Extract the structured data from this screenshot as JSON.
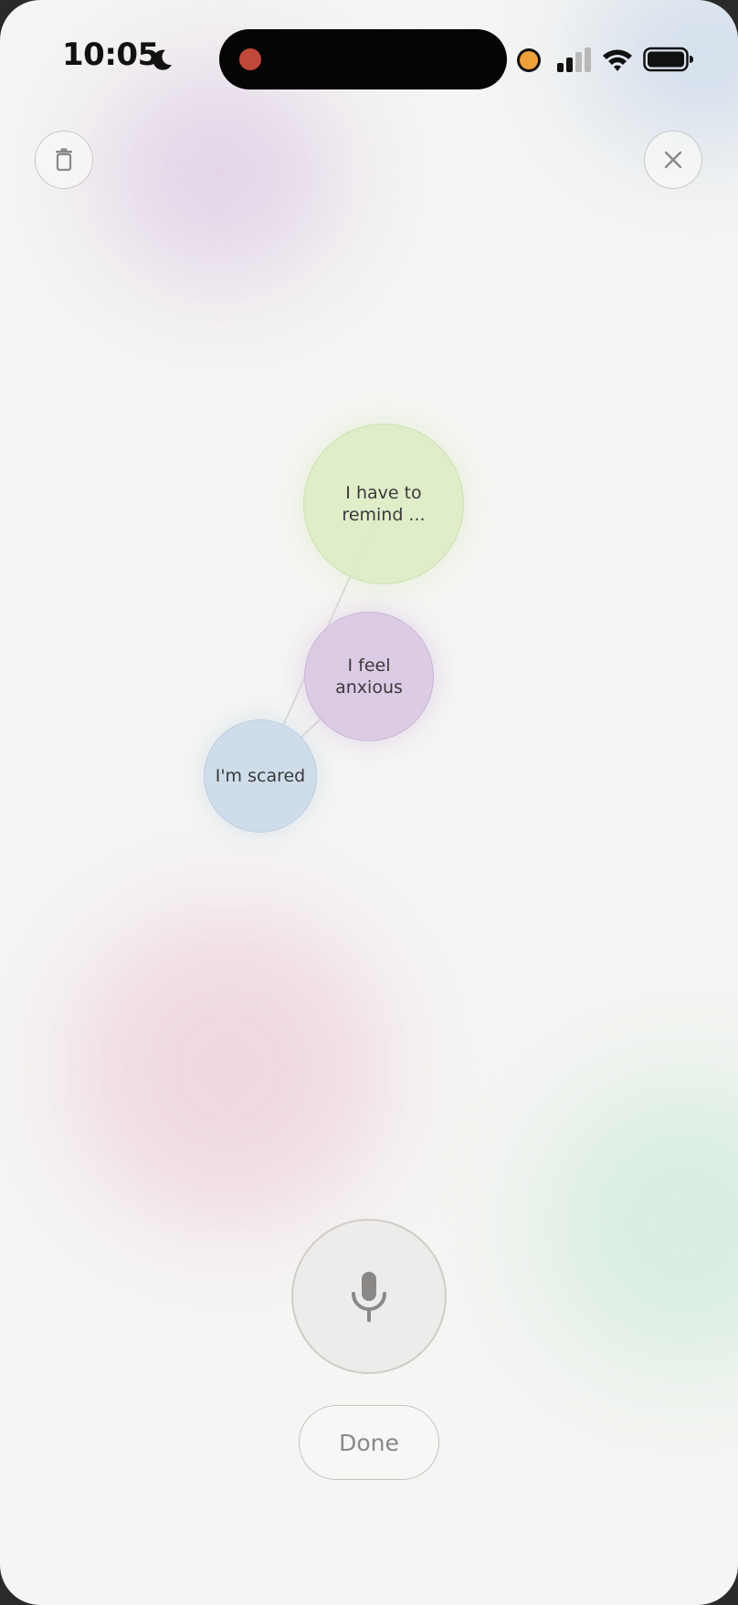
{
  "status_bar": {
    "time": "10:05",
    "focus_icon": "moon-icon",
    "recording_indicator": "red-dot",
    "mic_indicator": "orange-dot",
    "signal_icon": "cellular-signal-icon",
    "wifi_icon": "wifi-icon",
    "battery_icon": "battery-icon"
  },
  "toolbar": {
    "delete_icon": "trash-icon",
    "close_icon": "close-icon"
  },
  "thoughts": [
    {
      "label": "I have to remind ...",
      "color": "#dfecc8"
    },
    {
      "label": "I feel anxious",
      "color": "#dac8e4"
    },
    {
      "label": "I'm scared",
      "color": "#ccdbea"
    }
  ],
  "controls": {
    "mic_icon": "microphone-icon",
    "done_label": "Done"
  },
  "colors": {
    "background": "#f5f5f3",
    "button_border": "#c9c9c6",
    "text": "#3a3a3a",
    "muted_text": "#8a8886"
  }
}
